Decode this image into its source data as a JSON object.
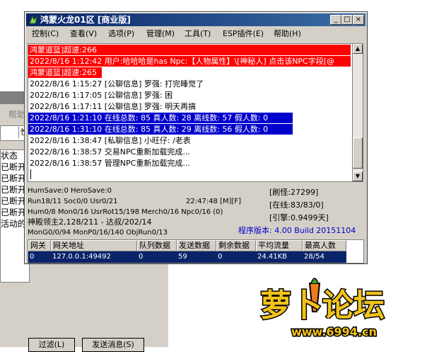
{
  "background_window": {
    "menu_label": "帮助",
    "tab_label": "性",
    "list_items": [
      "状态",
      "已断开",
      "已断开",
      "已断开",
      "已断开",
      "已断开",
      "活动的"
    ],
    "buttons": [
      "过滤(L)",
      "发送消息(S)"
    ]
  },
  "window": {
    "title": "鸿蒙火龙01区 [商业版]",
    "title_icon": "app-dragon-icon",
    "controls": [
      "minimize",
      "maximize",
      "close"
    ]
  },
  "menu": [
    "控制(C)",
    "查看(V)",
    "选项(P)",
    "管理(M)",
    "工具(T)",
    "ESP插件(E)",
    "帮助(H)"
  ],
  "log": [
    {
      "text": "鸿蒙道篮]超速:266",
      "style": "red"
    },
    {
      "text": "2022/8/16 1:12:42 用户:哈哈哈是has Npc:【人物属性】\\[神秘人] 点击该NPC字段[@",
      "style": "red"
    },
    {
      "text": "鸿蒙道篮]超速:265",
      "style": "red"
    },
    {
      "text": "2022/8/16 1:15:27 [公聊信息] 罗强: 打完睡觉了",
      "style": "normal"
    },
    {
      "text": "2022/8/16 1:17:05 [公聊信息] 罗强: 困",
      "style": "normal"
    },
    {
      "text": "2022/8/16 1:17:11 [公聊信息] 罗强: 明天再搞",
      "style": "normal"
    },
    {
      "text": "2022/8/16 1:21:10 在线总数: 85 真人数: 28 离线数: 57 假人数: 0",
      "style": "blue"
    },
    {
      "text": "2022/8/16 1:31:10 在线总数: 85 真人数: 29 离线数: 56 假人数: 0",
      "style": "blue"
    },
    {
      "text": "2022/8/16 1:38:47 [私聊信息] 小旺仔: /老表",
      "style": "normal"
    },
    {
      "text": "2022/8/16 1:38:57 交易NPC重新加载完成...",
      "style": "normal"
    },
    {
      "text": "2022/8/16 1:38:57 管理NPC重新加载完成...",
      "style": "normal"
    }
  ],
  "status": {
    "line1": "HumSave:0 HeroSave:0",
    "refresh": "[刷怪:27299]",
    "line2": "Run18/11 Soc0/0 Usr0/21",
    "time": "22:47:48 [M][F]",
    "online": "[在线:83/83/0]",
    "line3": "Hum0/8 Mon0/16 UsrRot15/198 Merch0/16 Npc0/16 (0)",
    "runtime": "[引擎:0.9499天]",
    "line4": "神殿领主2,128/211 - 达叔/202/14",
    "line5": "MonG0/0/94 MonP0/16/140 ObjRun0/13",
    "version": "程序版本: 4.00 Build 20151104"
  },
  "gateway_table": {
    "columns": [
      "网关",
      "网关地址",
      "队列数据",
      "发送数据",
      "剩余数据",
      "平均流量",
      "最高人数"
    ],
    "rows": [
      [
        "0",
        "127.0.0.1:49492",
        "0",
        "59",
        "0",
        "24.41KB",
        "28/54"
      ]
    ]
  },
  "watermark": {
    "title": "萝卜论坛",
    "url": "www.6994.cn"
  },
  "colors": {
    "title_bar": "#0a246a",
    "highlight_red": "#ff0000",
    "highlight_blue": "#0000cc",
    "window_face": "#d4d0c8"
  }
}
